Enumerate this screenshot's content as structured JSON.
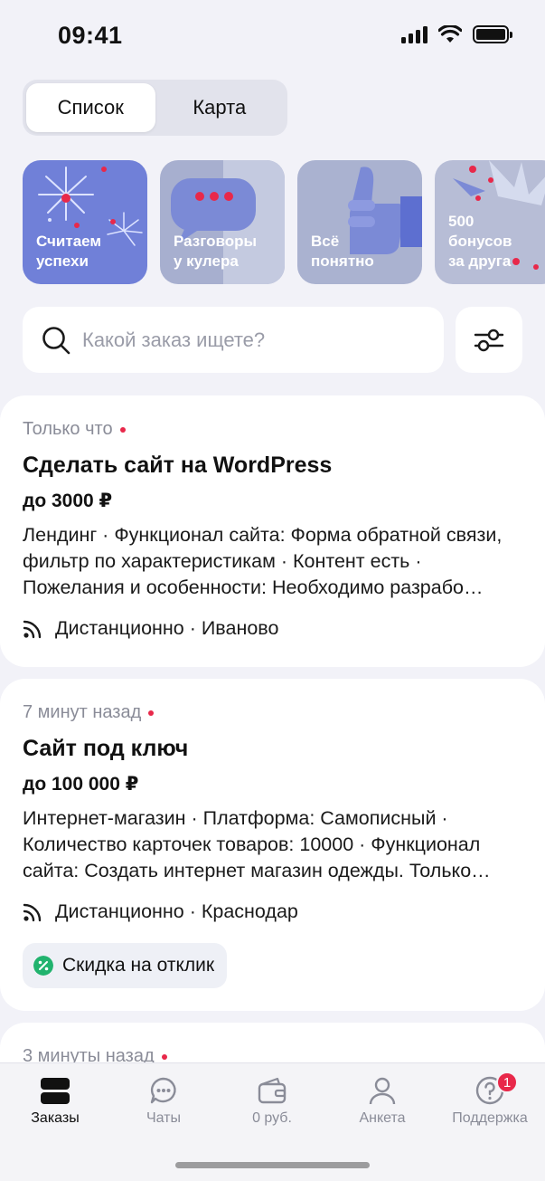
{
  "status_bar": {
    "time": "09:41"
  },
  "segmented": {
    "list_label": "Список",
    "map_label": "Карта"
  },
  "stories": [
    {
      "label": "Считаем\nуспехи"
    },
    {
      "label": "Разговоры\nу кулера"
    },
    {
      "label": "Всё\nпонятно"
    },
    {
      "label": "500\nбонусов\nза друга"
    }
  ],
  "search": {
    "placeholder": "Какой заказ ищете?"
  },
  "orders": [
    {
      "time": "Только что",
      "title": "Сделать сайт на WordPress",
      "price": "до 3000 ₽",
      "description": "Лендинг · Функционал сайта: Форма обратной связи, фильтр по характеристикам · Контент есть · Пожелания и особенности: Необходимо разрабо…",
      "location": "Дистанционно · Иваново"
    },
    {
      "time": "7 минут назад",
      "title": "Сайт под ключ",
      "price": "до 100 000 ₽",
      "description": "Интернет-магазин · Платформа: Самописный · Количество карточек товаров: 10000 · Функционал сайта: Создать интернет магазин одежды. Только…",
      "location": "Дистанционно · Краснодар",
      "badge": "Скидка на отклик"
    },
    {
      "time": "3 минуты назад"
    }
  ],
  "nav": {
    "orders": "Заказы",
    "chats": "Чаты",
    "wallet": "0 руб.",
    "profile": "Анкета",
    "support": "Поддержка",
    "support_badge": "1"
  },
  "colors": {
    "accent_red": "#e8284a",
    "badge_green": "#21b36e",
    "story_blue": "#6f7fd6"
  }
}
